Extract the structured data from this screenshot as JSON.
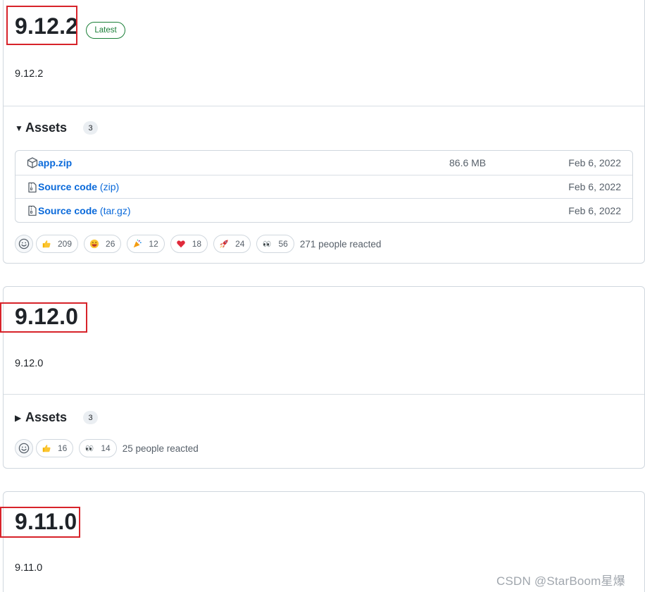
{
  "releases": [
    {
      "version": "9.12.2",
      "badge": "Latest",
      "description": "9.12.2",
      "assets_label": "Assets",
      "assets_count": "3",
      "expanded": true,
      "assets": [
        {
          "name": "app.zip",
          "suffix": "",
          "size": "86.6 MB",
          "date": "Feb 6, 2022",
          "icon": "package-icon"
        },
        {
          "name": "Source code",
          "suffix": "(zip)",
          "size": "",
          "date": "Feb 6, 2022",
          "icon": "file-zip-icon"
        },
        {
          "name": "Source code",
          "suffix": "(tar.gz)",
          "size": "",
          "date": "Feb 6, 2022",
          "icon": "file-zip-icon"
        }
      ],
      "reactions": [
        {
          "emoji": "thumbs-up",
          "count": "209"
        },
        {
          "emoji": "laugh",
          "count": "26"
        },
        {
          "emoji": "hooray",
          "count": "12"
        },
        {
          "emoji": "heart",
          "count": "18"
        },
        {
          "emoji": "rocket",
          "count": "24"
        },
        {
          "emoji": "eyes",
          "count": "56"
        }
      ],
      "reaction_summary": "271 people reacted"
    },
    {
      "version": "9.12.0",
      "description": "9.12.0",
      "assets_label": "Assets",
      "assets_count": "3",
      "expanded": false,
      "reactions": [
        {
          "emoji": "thumbs-up",
          "count": "16"
        },
        {
          "emoji": "eyes",
          "count": "14"
        }
      ],
      "reaction_summary": "25 people reacted"
    },
    {
      "version": "9.11.0",
      "description": "9.11.0"
    }
  ],
  "watermark": "CSDN @StarBoom星爆",
  "colors": {
    "link": "#0969da",
    "latest_green": "#1a7f37",
    "highlight_red": "#d7232a",
    "muted": "#57606a"
  }
}
